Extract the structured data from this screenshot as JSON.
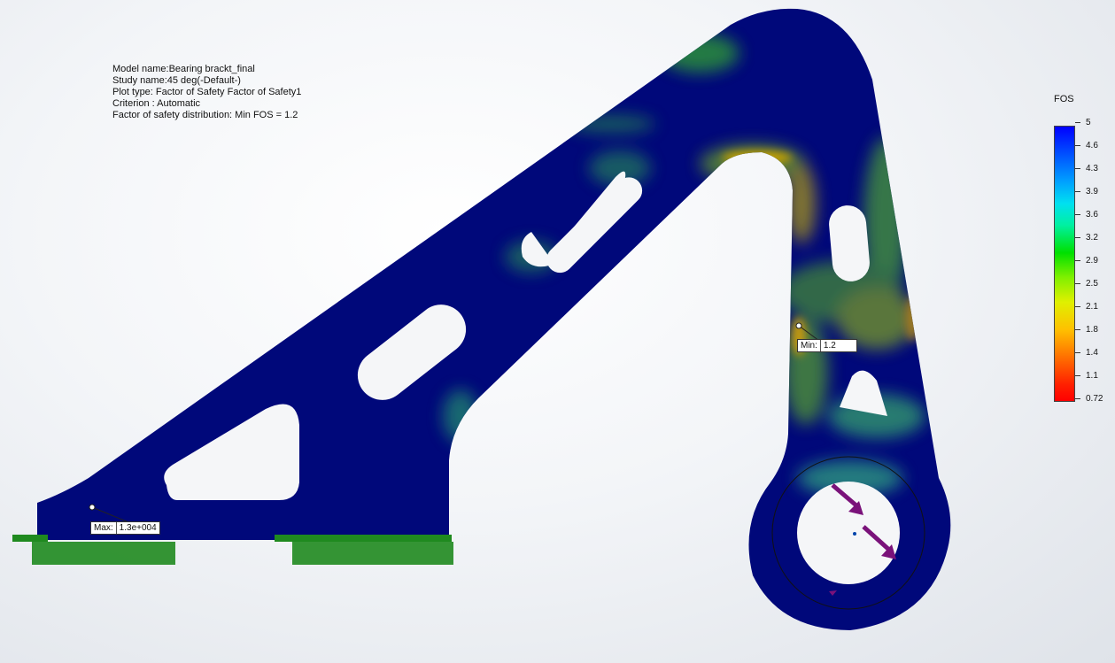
{
  "plot_info": {
    "model_name": "Model name:Bearing brackt_final",
    "study_name": "Study name:45 deg(-Default-)",
    "plot_type": "Plot type: Factor of Safety Factor of Safety1",
    "criterion": "Criterion : Automatic",
    "distribution": "Factor of safety distribution: Min FOS = 1.2"
  },
  "max_probe": {
    "label": "Max:",
    "value": "1.3e+004"
  },
  "min_probe": {
    "label": "Min:",
    "value": "1.2"
  },
  "legend": {
    "title": "FOS",
    "ticks": [
      "5",
      "4.6",
      "4.3",
      "3.9",
      "3.6",
      "3.2",
      "2.9",
      "2.5",
      "2.1",
      "1.8",
      "1.4",
      "1.1",
      "0.72"
    ]
  },
  "colors": {
    "part_body": "#00087a",
    "fixture_green": "#1f8a1f",
    "load_arrow": "#7a127a",
    "high_stress": "#c8a000"
  },
  "icons": {
    "fixture": "fixed-support-arrows",
    "load": "bearing-load-arrow"
  }
}
